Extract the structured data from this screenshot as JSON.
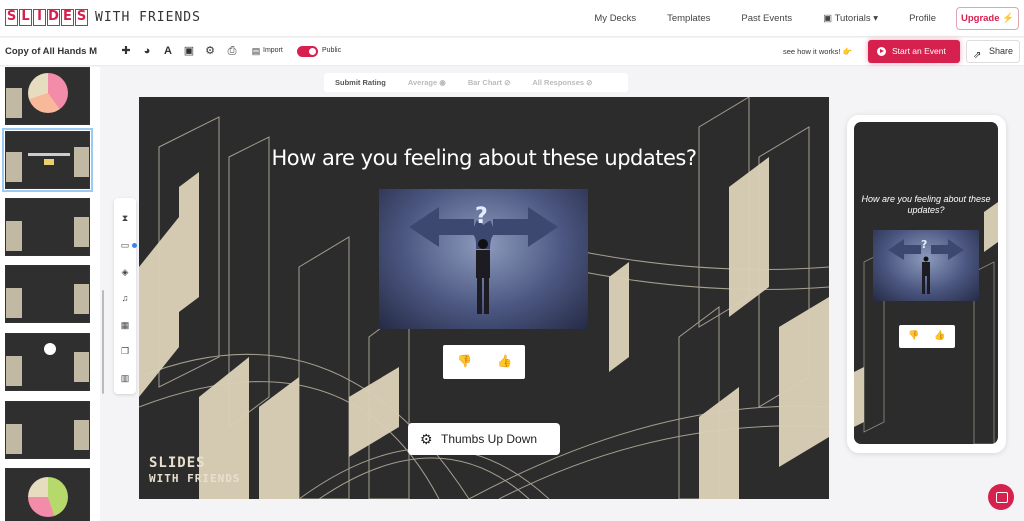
{
  "brand": {
    "letters": [
      "S",
      "L",
      "I",
      "D",
      "E",
      "S"
    ],
    "rest": "WITH FRIENDS",
    "accent": "#d6204e"
  },
  "nav": {
    "my_decks": "My Decks",
    "templates": "Templates",
    "past_events": "Past Events",
    "tutorials": "Tutorials",
    "profile": "Profile",
    "upgrade": "Upgrade"
  },
  "toolbar": {
    "deck_title": "Copy of All Hands M",
    "import_label": "Import",
    "public_label": "Public",
    "public_on": true,
    "how_it_works": "see how it works!",
    "start_event": "Start an Event",
    "share": "Share"
  },
  "tabs": [
    {
      "label": "Submit Rating",
      "active": true
    },
    {
      "label": "Average",
      "active": true
    },
    {
      "label": "Bar Chart",
      "active": false
    },
    {
      "label": "All Responses",
      "active": false
    }
  ],
  "slide": {
    "question": "How are you feeling about these updates?",
    "question_type": "Thumbs Up Down",
    "thumbs_down": "👎",
    "thumbs_up": "👍",
    "watermark_line1": "SLIDES",
    "watermark_line2": "WITH FRIENDS"
  },
  "phone": {
    "question": "How are you feeling about these updates?"
  },
  "colors": {
    "slide_bg": "#2c2c2d",
    "deco": "#e6dcc0",
    "accent": "#d6204e"
  },
  "icons": [
    "plus-icon",
    "palette-icon",
    "text-icon",
    "image-icon",
    "gear-icon",
    "printer-icon",
    "import-icon",
    "hourglass-icon",
    "media-icon",
    "paint-bucket-icon",
    "music-icon",
    "lock-icon",
    "copy-icon",
    "trash-icon",
    "share-icon",
    "chat-icon"
  ]
}
